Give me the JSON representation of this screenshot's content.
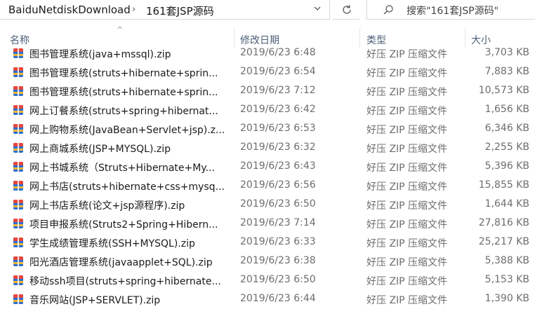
{
  "address": {
    "crumbs": [
      "BaiduNetdiskDownload",
      "161套JSP源码"
    ],
    "separator": "›"
  },
  "search": {
    "placeholder": "搜索\"161套JSP源码\""
  },
  "columns": {
    "name": "名称",
    "date": "修改日期",
    "type": "类型",
    "size": "大小"
  },
  "files": [
    {
      "name": "图书管理系统(java+mssql).zip",
      "date": "2019/6/23 6:48",
      "type": "好压 ZIP 压缩文件",
      "size": "3,703 KB"
    },
    {
      "name": "图书管理系统(struts+hibernate+sprin...",
      "date": "2019/6/23 6:54",
      "type": "好压 ZIP 压缩文件",
      "size": "7,883 KB"
    },
    {
      "name": "图书管理系统(struts+hibernate+sprin...",
      "date": "2019/6/23 7:12",
      "type": "好压 ZIP 压缩文件",
      "size": "10,573 KB"
    },
    {
      "name": "网上订餐系统(struts+spring+hibernat...",
      "date": "2019/6/23 6:42",
      "type": "好压 ZIP 压缩文件",
      "size": "1,656 KB"
    },
    {
      "name": "网上购物系统(JavaBean+Servlet+jsp).z...",
      "date": "2019/6/23 6:53",
      "type": "好压 ZIP 压缩文件",
      "size": "6,346 KB"
    },
    {
      "name": "网上商城系统(JSP+MYSQL).zip",
      "date": "2019/6/23 6:32",
      "type": "好压 ZIP 压缩文件",
      "size": "2,255 KB"
    },
    {
      "name": "网上书城系统（Struts+Hibernate+My...",
      "date": "2019/6/23 6:43",
      "type": "好压 ZIP 压缩文件",
      "size": "5,396 KB"
    },
    {
      "name": "网上书店(struts+hibernate+css+mysq...",
      "date": "2019/6/23 6:56",
      "type": "好压 ZIP 压缩文件",
      "size": "15,855 KB"
    },
    {
      "name": "网上书店系统(论文+jsp源程序).zip",
      "date": "2019/6/23 6:50",
      "type": "好压 ZIP 压缩文件",
      "size": "1,644 KB"
    },
    {
      "name": "项目申报系统(Struts2+Spring+Hibern...",
      "date": "2019/6/23 7:14",
      "type": "好压 ZIP 压缩文件",
      "size": "27,816 KB"
    },
    {
      "name": "学生成绩管理系统(SSH+MYSQL).zip",
      "date": "2019/6/23 6:33",
      "type": "好压 ZIP 压缩文件",
      "size": "25,217 KB"
    },
    {
      "name": "阳光酒店管理系统(javaapplet+SQL).zip",
      "date": "2019/6/23 6:38",
      "type": "好压 ZIP 压缩文件",
      "size": "5,388 KB"
    },
    {
      "name": "移动ssh项目(struts+spring+hibernate...",
      "date": "2019/6/23 6:50",
      "type": "好压 ZIP 压缩文件",
      "size": "5,153 KB"
    },
    {
      "name": "音乐网站(JSP+SERVLET).zip",
      "date": "2019/6/23 6:44",
      "type": "好压 ZIP 压缩文件",
      "size": "1,390 KB"
    }
  ]
}
